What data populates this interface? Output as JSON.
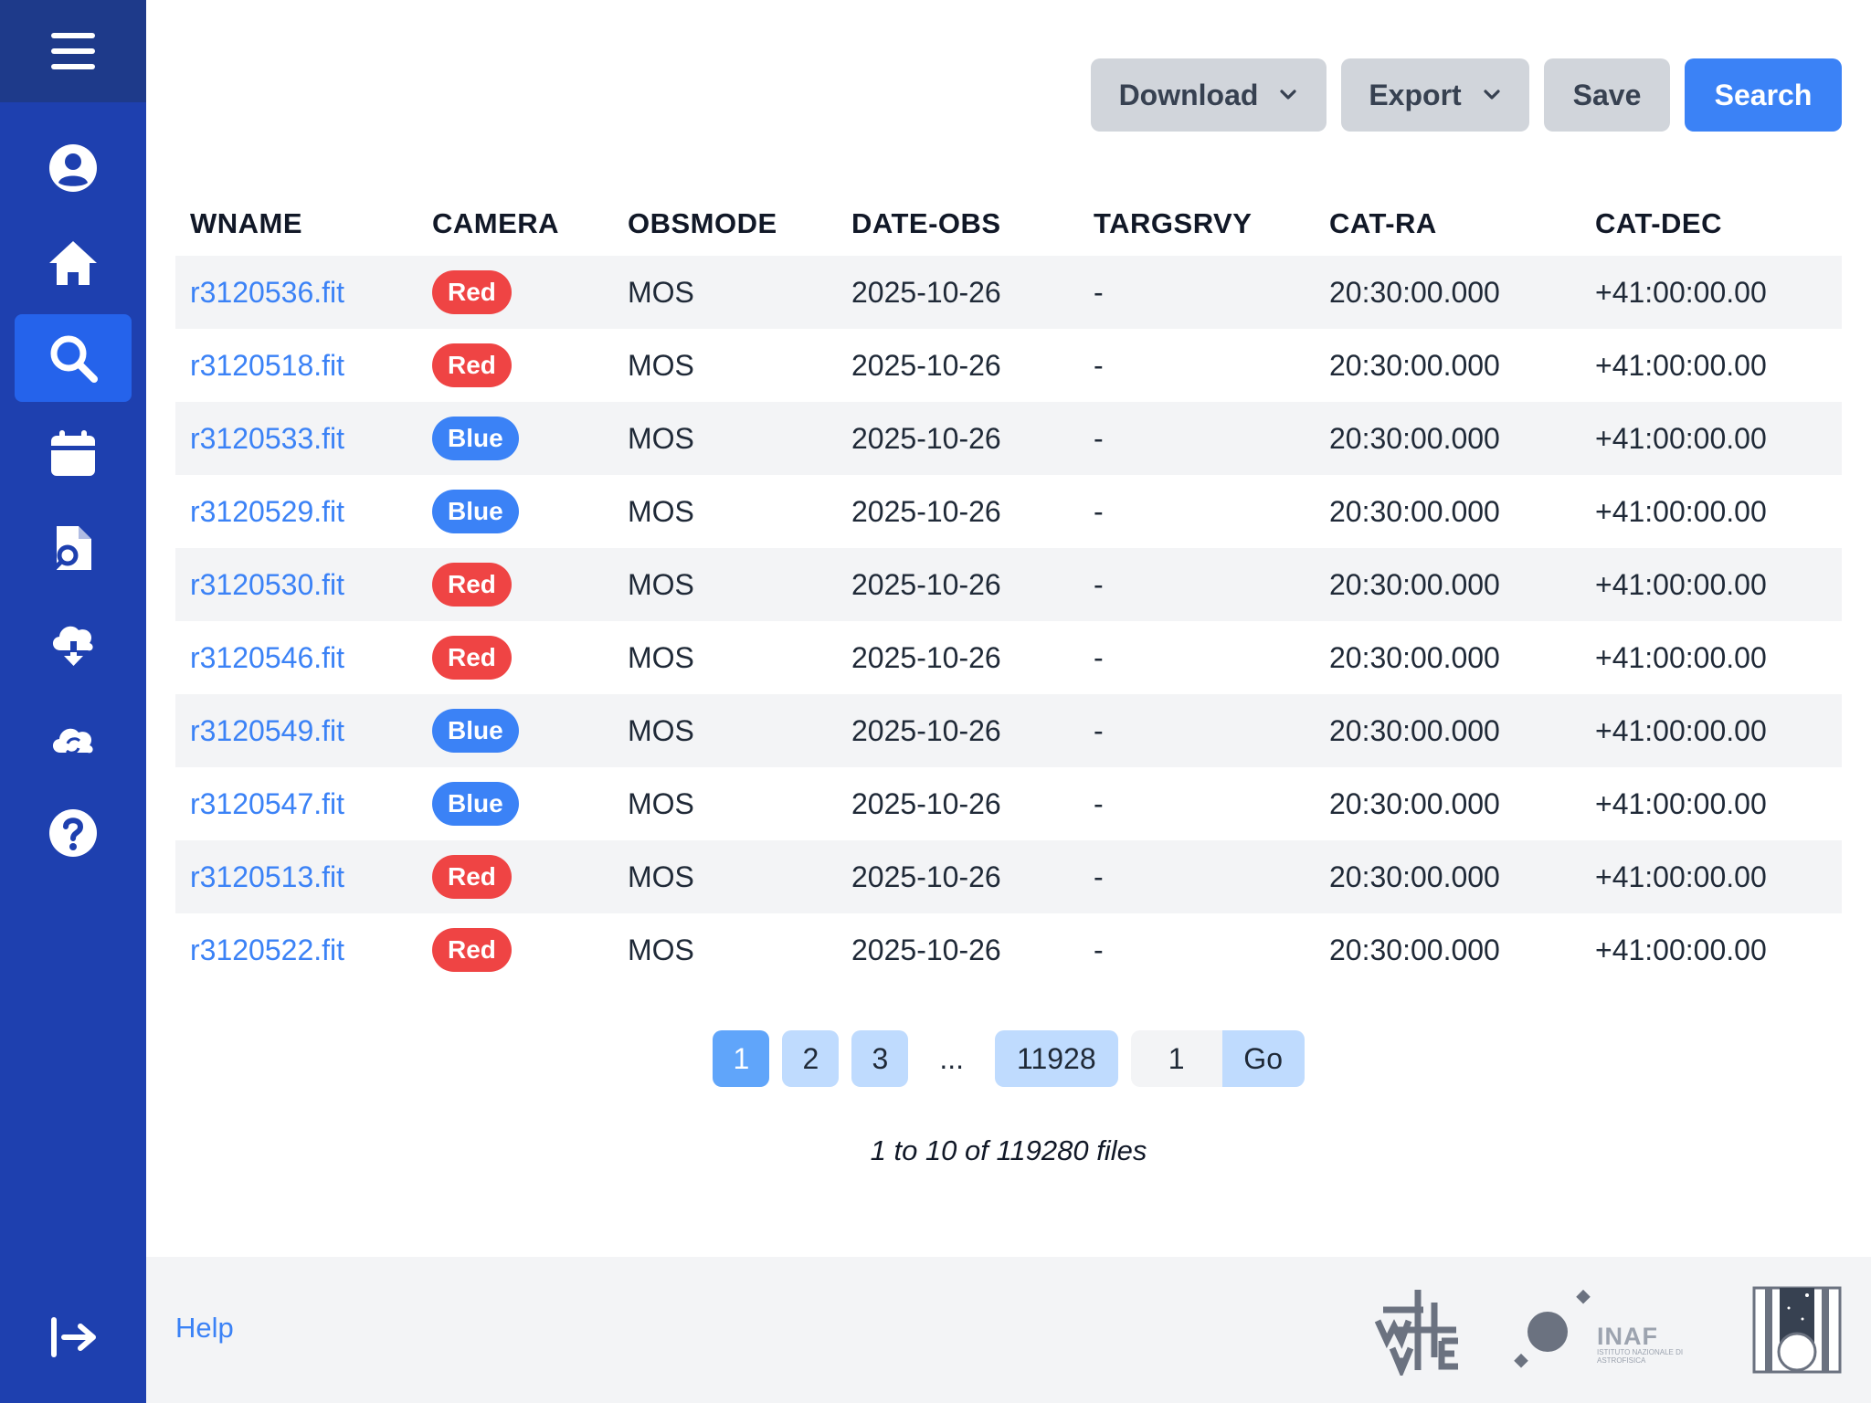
{
  "toolbar": {
    "download_label": "Download",
    "export_label": "Export",
    "save_label": "Save",
    "search_label": "Search"
  },
  "table": {
    "columns": [
      "WNAME",
      "CAMERA",
      "OBSMODE",
      "DATE-OBS",
      "TARGSRVY",
      "CAT-RA",
      "CAT-DEC"
    ],
    "rows": [
      {
        "wname": "r3120536.fit",
        "camera": "Red",
        "obsmode": "MOS",
        "date_obs": "2025-10-26",
        "targsrvy": "-",
        "cat_ra": "20:30:00.000",
        "cat_dec": "+41:00:00.00"
      },
      {
        "wname": "r3120518.fit",
        "camera": "Red",
        "obsmode": "MOS",
        "date_obs": "2025-10-26",
        "targsrvy": "-",
        "cat_ra": "20:30:00.000",
        "cat_dec": "+41:00:00.00"
      },
      {
        "wname": "r3120533.fit",
        "camera": "Blue",
        "obsmode": "MOS",
        "date_obs": "2025-10-26",
        "targsrvy": "-",
        "cat_ra": "20:30:00.000",
        "cat_dec": "+41:00:00.00"
      },
      {
        "wname": "r3120529.fit",
        "camera": "Blue",
        "obsmode": "MOS",
        "date_obs": "2025-10-26",
        "targsrvy": "-",
        "cat_ra": "20:30:00.000",
        "cat_dec": "+41:00:00.00"
      },
      {
        "wname": "r3120530.fit",
        "camera": "Red",
        "obsmode": "MOS",
        "date_obs": "2025-10-26",
        "targsrvy": "-",
        "cat_ra": "20:30:00.000",
        "cat_dec": "+41:00:00.00"
      },
      {
        "wname": "r3120546.fit",
        "camera": "Red",
        "obsmode": "MOS",
        "date_obs": "2025-10-26",
        "targsrvy": "-",
        "cat_ra": "20:30:00.000",
        "cat_dec": "+41:00:00.00"
      },
      {
        "wname": "r3120549.fit",
        "camera": "Blue",
        "obsmode": "MOS",
        "date_obs": "2025-10-26",
        "targsrvy": "-",
        "cat_ra": "20:30:00.000",
        "cat_dec": "+41:00:00.00"
      },
      {
        "wname": "r3120547.fit",
        "camera": "Blue",
        "obsmode": "MOS",
        "date_obs": "2025-10-26",
        "targsrvy": "-",
        "cat_ra": "20:30:00.000",
        "cat_dec": "+41:00:00.00"
      },
      {
        "wname": "r3120513.fit",
        "camera": "Red",
        "obsmode": "MOS",
        "date_obs": "2025-10-26",
        "targsrvy": "-",
        "cat_ra": "20:30:00.000",
        "cat_dec": "+41:00:00.00"
      },
      {
        "wname": "r3120522.fit",
        "camera": "Red",
        "obsmode": "MOS",
        "date_obs": "2025-10-26",
        "targsrvy": "-",
        "cat_ra": "20:30:00.000",
        "cat_dec": "+41:00:00.00"
      }
    ]
  },
  "camera_colors": {
    "Red": "#ef4444",
    "Blue": "#3b82f6"
  },
  "pagination": {
    "pages": [
      "1",
      "2",
      "3"
    ],
    "ellipsis": "...",
    "last_page": "11928",
    "current_page": "1",
    "jump_value": "1",
    "go_label": "Go"
  },
  "summary": "1 to 10 of 119280 files",
  "footer": {
    "help_label": "Help",
    "inaf_logo_text": "INAF",
    "inaf_logo_subtext": "ISTITUTO NAZIONALE DI ASTROFISICA"
  },
  "sidebar": {
    "active_item": "search",
    "items": [
      "menu-icon",
      "user-icon",
      "home-icon",
      "search-icon",
      "calendar-icon",
      "file-search-icon",
      "cloud-download-icon",
      "cloud-sync-icon",
      "help-icon",
      "logout-icon"
    ]
  },
  "colors": {
    "sidebar": "#1e40af",
    "sidebar_top": "#1e3a8a",
    "accent": "#3b82f6"
  }
}
